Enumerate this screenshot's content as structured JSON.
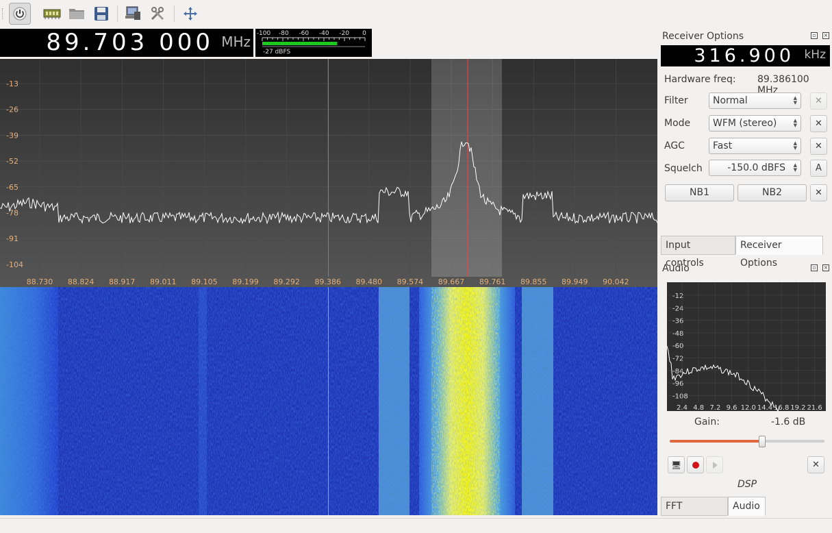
{
  "toolbar": {
    "icons": [
      "power-icon",
      "device-icon",
      "folder-icon",
      "save-icon",
      "remote-control-icon",
      "tools-icon",
      "fullscreen-icon"
    ]
  },
  "frequency": {
    "value": "89.703 000",
    "unit": "MHz"
  },
  "meter": {
    "scale": [
      "-100",
      "-80",
      "-60",
      "-40",
      "-20",
      "0"
    ],
    "level_text": "-27 dBFS",
    "level_fraction": 0.73
  },
  "spectrum": {
    "y_ticks": [
      "-13",
      "-26",
      "-39",
      "-52",
      "-65",
      "-78",
      "-91",
      "-104"
    ],
    "x_ticks": [
      "88.730",
      "88.824",
      "88.917",
      "89.011",
      "89.105",
      "89.199",
      "89.292",
      "89.386",
      "89.480",
      "89.574",
      "89.667",
      "89.761",
      "89.855",
      "89.949",
      "90.042"
    ]
  },
  "receiver_options": {
    "title": "Receiver Options",
    "offset": {
      "value": "316.900",
      "unit": "kHz"
    },
    "hardware_label": "Hardware freq:",
    "hardware_value": "89.386100 MHz",
    "filter": {
      "label": "Filter",
      "value": "Normal"
    },
    "mode": {
      "label": "Mode",
      "value": "WFM (stereo)"
    },
    "agc": {
      "label": "AGC",
      "value": "Fast"
    },
    "squelch": {
      "label": "Squelch",
      "value": "-150.0 dBFS",
      "auto_label": "A"
    },
    "nb1": "NB1",
    "nb2": "NB2"
  },
  "tabs_top": {
    "input_controls": "Input controls",
    "receiver_options": "Receiver Options"
  },
  "audio": {
    "title": "Audio",
    "y_ticks": [
      "-12",
      "-24",
      "-36",
      "-48",
      "-60",
      "-72",
      "-84",
      "-96",
      "-108"
    ],
    "x_ticks": [
      "2.4",
      "4.8",
      "7.2",
      "9.6",
      "12.0",
      "14.4",
      "16.8",
      "19.2",
      "21.6"
    ],
    "gain_label": "Gain:",
    "gain_value": "-1.6 dB",
    "gain_fraction": 0.6,
    "dsp_label": "DSP"
  },
  "tabs_bottom": {
    "fft_settings": "FFT Settings",
    "audio": "Audio"
  }
}
